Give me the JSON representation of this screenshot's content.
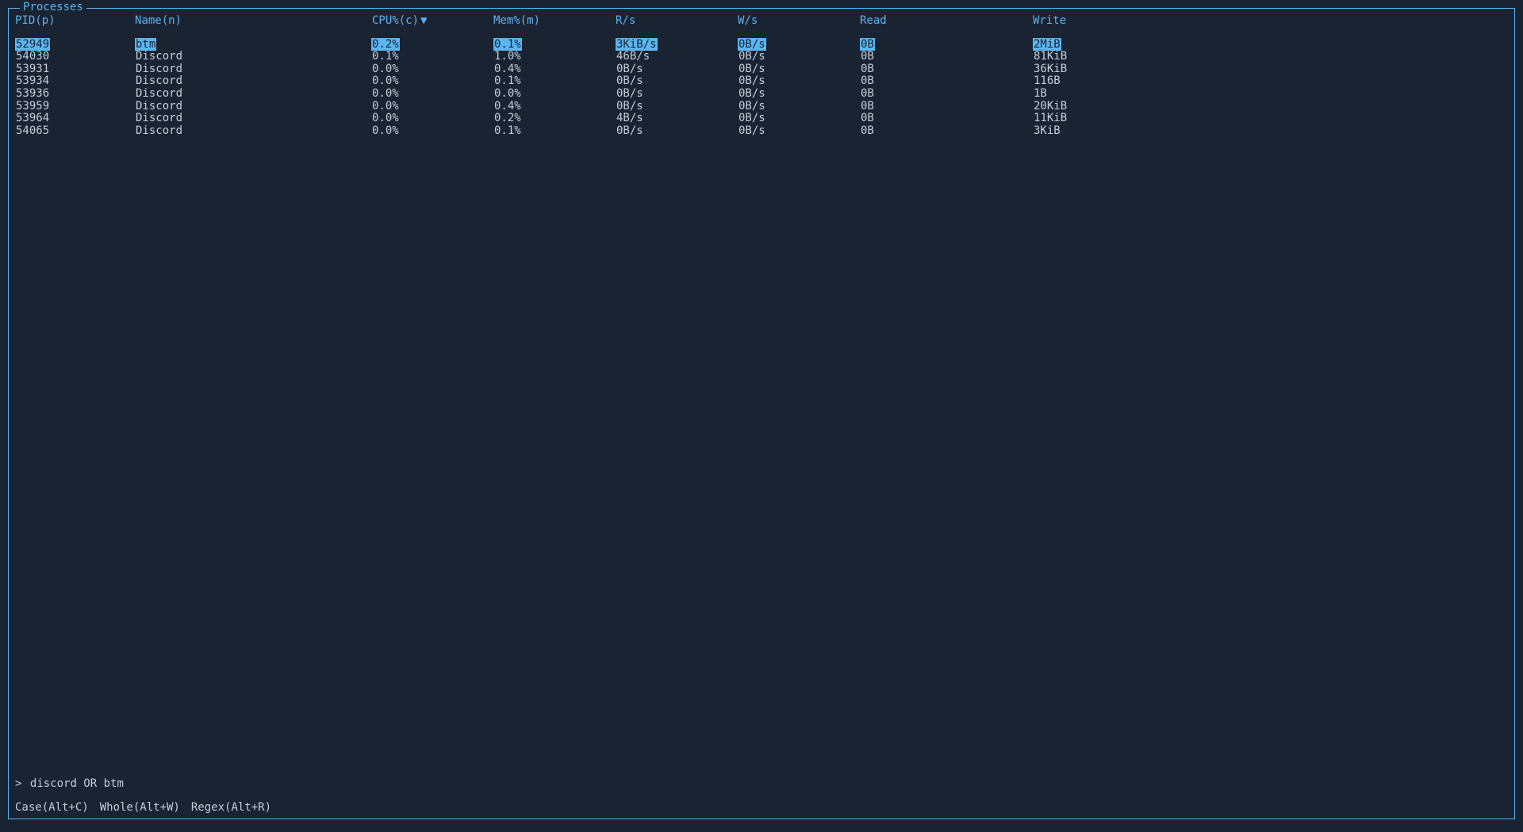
{
  "panel": {
    "title": "Processes"
  },
  "headers": {
    "pid": "PID(p)",
    "name": "Name(n)",
    "cpu": "CPU%(c)",
    "mem": "Mem%(m)",
    "rs": "R/s",
    "ws": "W/s",
    "read": "Read",
    "write": "Write",
    "sort_arrow": "▼"
  },
  "rows": [
    {
      "pid": "52949",
      "name": "btm",
      "cpu": "0.2%",
      "mem": "0.1%",
      "rs": "3KiB/s",
      "ws": "0B/s",
      "read": "0B",
      "write": "2MiB",
      "selected": true
    },
    {
      "pid": "54030",
      "name": "Discord",
      "cpu": "0.1%",
      "mem": "1.0%",
      "rs": "46B/s",
      "ws": "0B/s",
      "read": "0B",
      "write": "81KiB",
      "selected": false
    },
    {
      "pid": "53931",
      "name": "Discord",
      "cpu": "0.0%",
      "mem": "0.4%",
      "rs": "0B/s",
      "ws": "0B/s",
      "read": "0B",
      "write": "36KiB",
      "selected": false
    },
    {
      "pid": "53934",
      "name": "Discord",
      "cpu": "0.0%",
      "mem": "0.1%",
      "rs": "0B/s",
      "ws": "0B/s",
      "read": "0B",
      "write": "116B",
      "selected": false
    },
    {
      "pid": "53936",
      "name": "Discord",
      "cpu": "0.0%",
      "mem": "0.0%",
      "rs": "0B/s",
      "ws": "0B/s",
      "read": "0B",
      "write": "1B",
      "selected": false
    },
    {
      "pid": "53959",
      "name": "Discord",
      "cpu": "0.0%",
      "mem": "0.4%",
      "rs": "0B/s",
      "ws": "0B/s",
      "read": "0B",
      "write": "20KiB",
      "selected": false
    },
    {
      "pid": "53964",
      "name": "Discord",
      "cpu": "0.0%",
      "mem": "0.2%",
      "rs": "4B/s",
      "ws": "0B/s",
      "read": "0B",
      "write": "11KiB",
      "selected": false
    },
    {
      "pid": "54065",
      "name": "Discord",
      "cpu": "0.0%",
      "mem": "0.1%",
      "rs": "0B/s",
      "ws": "0B/s",
      "read": "0B",
      "write": "3KiB",
      "selected": false
    }
  ],
  "search": {
    "prompt": ">",
    "query": "discord OR btm"
  },
  "options": {
    "case": "Case(Alt+C)",
    "whole": "Whole(Alt+W)",
    "regex": "Regex(Alt+R)"
  },
  "colors": {
    "accent": "#5bb5f0",
    "bg": "#1a2332",
    "fg": "#c5cdd8"
  }
}
